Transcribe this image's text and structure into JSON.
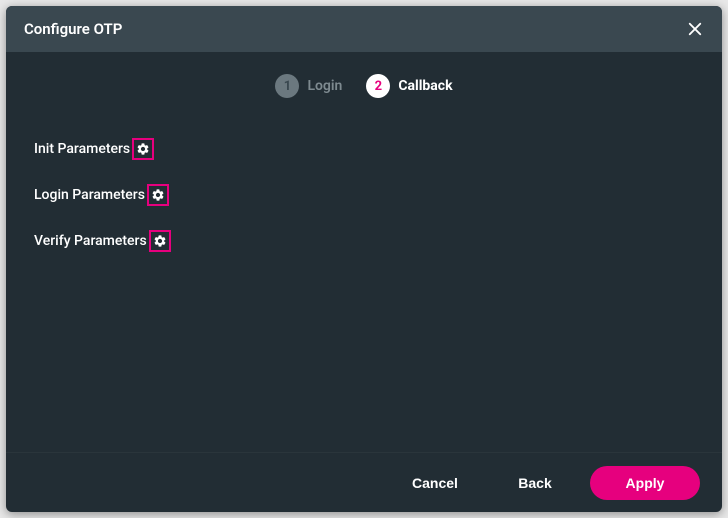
{
  "dialog": {
    "title": "Configure OTP"
  },
  "stepper": {
    "steps": [
      {
        "num": "1",
        "label": "Login",
        "active": false
      },
      {
        "num": "2",
        "label": "Callback",
        "active": true
      }
    ]
  },
  "params": [
    {
      "label": "Init Parameters"
    },
    {
      "label": "Login Parameters"
    },
    {
      "label": "Verify Parameters"
    }
  ],
  "footer": {
    "cancel": "Cancel",
    "back": "Back",
    "apply": "Apply"
  }
}
